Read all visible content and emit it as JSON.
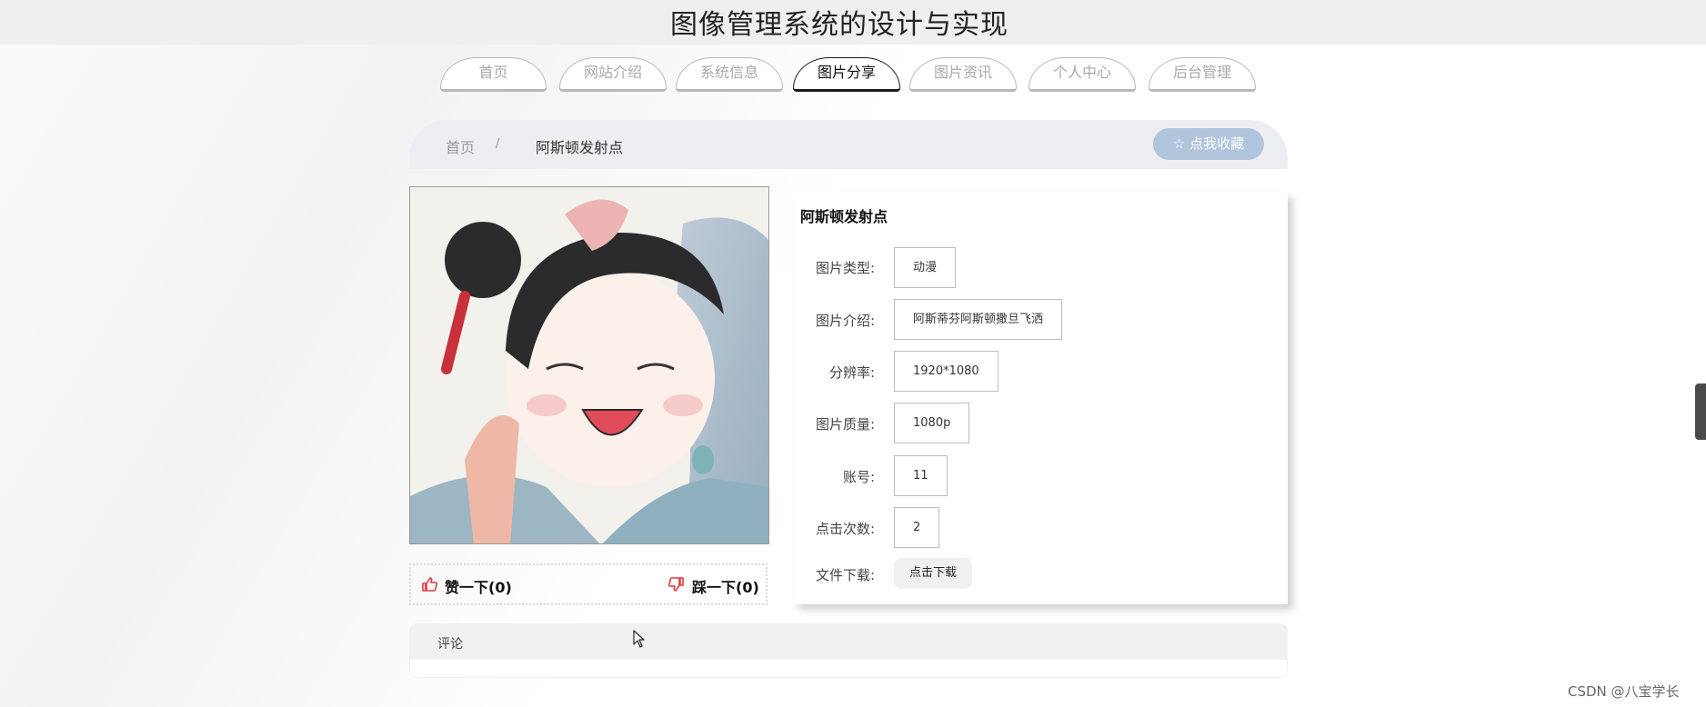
{
  "site_title": "图像管理系统的设计与实现",
  "nav": {
    "tabs": [
      {
        "label": "首页"
      },
      {
        "label": "网站介绍"
      },
      {
        "label": "系统信息"
      },
      {
        "label": "图片分享"
      },
      {
        "label": "图片资讯"
      },
      {
        "label": "个人中心"
      },
      {
        "label": "后台管理"
      }
    ],
    "active": "图片分享"
  },
  "breadcrumb": {
    "home": "首页",
    "separator": "/",
    "current": "阿斯顿发射点"
  },
  "favorite_button": {
    "icon": "star-outline-icon",
    "label": "点我收藏"
  },
  "vote": {
    "like_label": "赞一下(0)",
    "like_icon": "thumbs-up-icon",
    "dislike_label": "踩一下(0)",
    "dislike_icon": "thumbs-down-icon",
    "color": "#e23b3b"
  },
  "detail": {
    "title": "阿斯顿发射点",
    "fields": [
      {
        "label": "图片类型:",
        "value": "动漫"
      },
      {
        "label": "图片介绍:",
        "value": "阿斯蒂芬阿斯顿撒旦飞洒"
      },
      {
        "label": "分辨率:",
        "value": "1920*1080"
      },
      {
        "label": "图片质量:",
        "value": "1080p"
      },
      {
        "label": "账号:",
        "value": "11"
      },
      {
        "label": "点击次数:",
        "value": "2"
      }
    ],
    "download_label": "文件下载:",
    "download_button": "点击下载"
  },
  "comments": {
    "label": "评论"
  },
  "watermark": "CSDN @八宝学长",
  "colors": {
    "favorite_bg": "#b1c5dd",
    "topbar_bg": "#eeeff1",
    "active_tab_border": "#1a1a1a"
  }
}
